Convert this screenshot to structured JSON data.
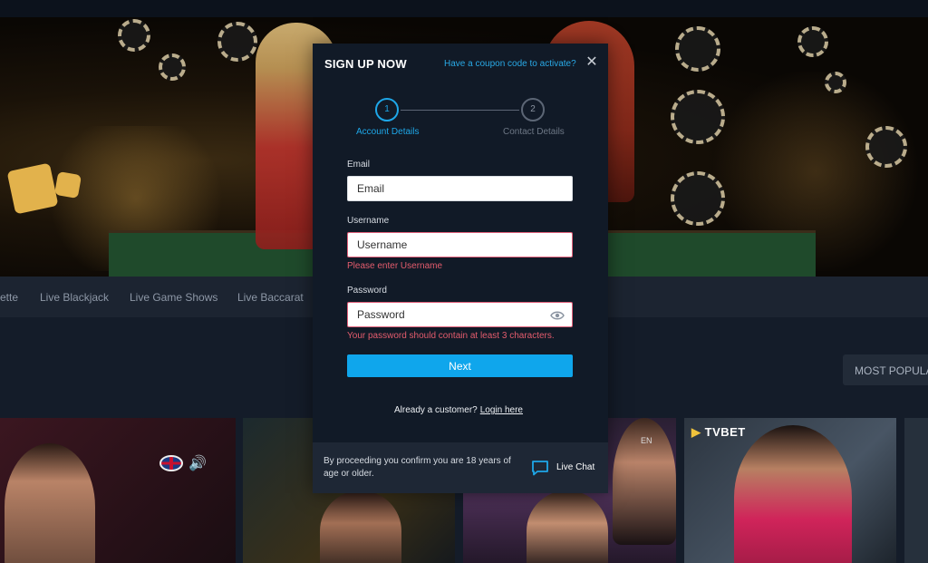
{
  "categories": [
    "ette",
    "Live Blackjack",
    "Live Game Shows",
    "Live Baccarat"
  ],
  "sort_button": "MOST POPULA",
  "tiles": {
    "tvbet_logo": "TVBET",
    "en_tag": "EN"
  },
  "modal": {
    "title": "SIGN UP NOW",
    "coupon_link": "Have a coupon code to activate?",
    "close": "✕",
    "steps": [
      {
        "number": "1",
        "label": "Account Details"
      },
      {
        "number": "2",
        "label": "Contact Details"
      }
    ],
    "email": {
      "label": "Email",
      "placeholder": "Email"
    },
    "username": {
      "label": "Username",
      "placeholder": "Username",
      "error": "Please enter Username"
    },
    "password": {
      "label": "Password",
      "placeholder": "Password",
      "error": "Your password should contain at least 3 characters."
    },
    "next_button": "Next",
    "already_customer": "Already a customer?",
    "login_link": "Login here",
    "footer_note": "By proceeding you confirm you are 18 years of age or older.",
    "live_chat": "Live Chat"
  },
  "colors": {
    "accent": "#0fa6ec",
    "error": "#e45c6d",
    "modal_bg": "#111a27",
    "footer_bg": "#1e2735"
  }
}
